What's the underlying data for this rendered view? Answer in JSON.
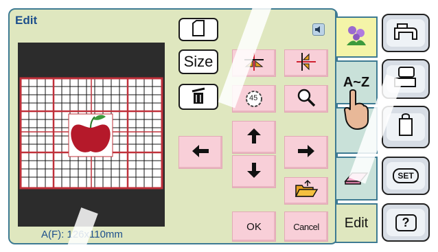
{
  "title": "Edit",
  "preview": {
    "size_readout": "A(F): 126x110mm"
  },
  "buttons": {
    "size_label": "Size",
    "ok_label": "OK",
    "cancel_label": "Cancel",
    "rotate_label": "45"
  },
  "tabs": {
    "font_label": "A~Z",
    "edit_label": "Edit"
  },
  "side": {
    "set_label": "SET",
    "help_label": "?"
  },
  "icons": {
    "info": "speaker-icon",
    "new": "new-page-icon",
    "delete": "trash-icon",
    "mirror_v": "mirror-vertical-icon",
    "mirror_h": "mirror-horizontal-icon",
    "rotate": "rotate-icon",
    "zoom": "magnifier-icon",
    "arrows": [
      "left-arrow-icon",
      "up-arrow-icon",
      "down-arrow-icon",
      "right-arrow-icon"
    ],
    "open": "open-folder-icon",
    "flower": "flower-pattern-icon",
    "eraser": "eraser-icon"
  },
  "colors": {
    "panel_bg": "#dfe7bf",
    "frame": "#3d7a92",
    "pink": "#f8cfd8",
    "tab_bg": "#c9e1d9",
    "grid_red": "#c0303a",
    "apple": "#b5192a"
  }
}
